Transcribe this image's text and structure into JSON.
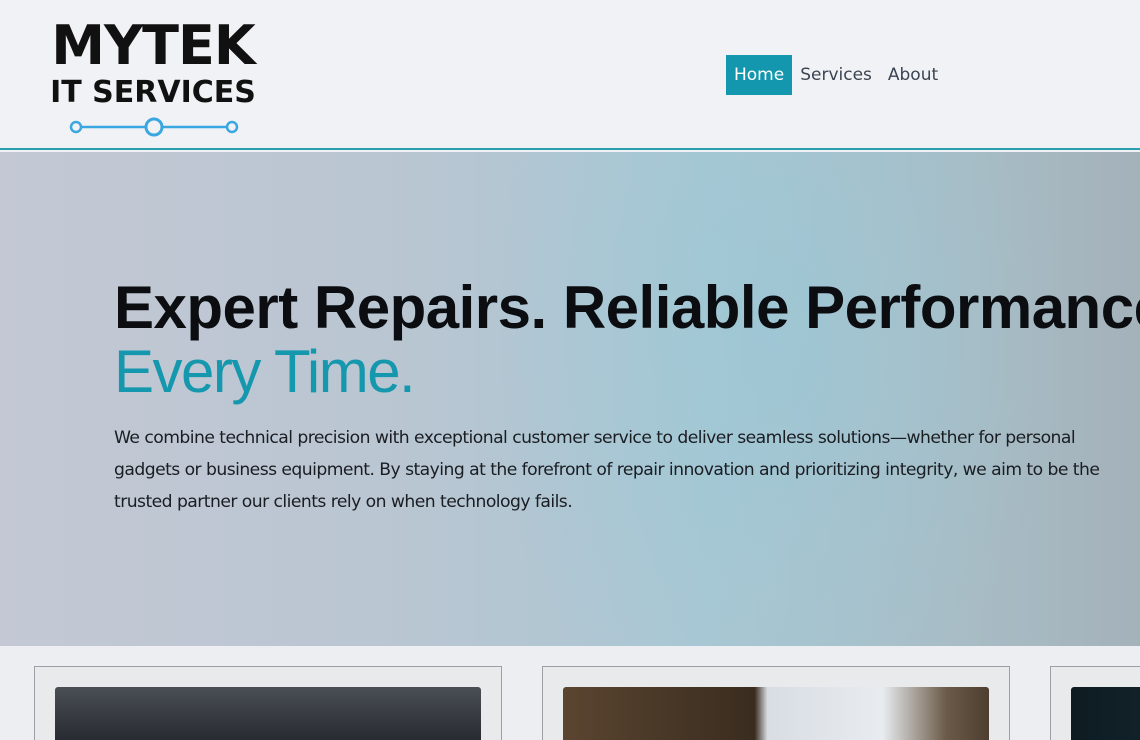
{
  "brand": {
    "logo_main": "MYTEK",
    "logo_sub": "IT SERVICES",
    "accent_color": "#1397ae"
  },
  "nav": {
    "items": [
      {
        "label": "Home",
        "active": true
      },
      {
        "label": "Services",
        "active": false
      },
      {
        "label": "About",
        "active": false
      }
    ]
  },
  "hero": {
    "title": "Expert Repairs. Reliable Performance.",
    "accent": "Every Time.",
    "text": "We combine technical precision with exceptional customer service to deliver seamless solutions—whether for personal gadgets or business equipment. By staying at the forefront of repair innovation and prioritizing integrity, we aim to be the trusted partner our clients rely on when technology fails."
  }
}
